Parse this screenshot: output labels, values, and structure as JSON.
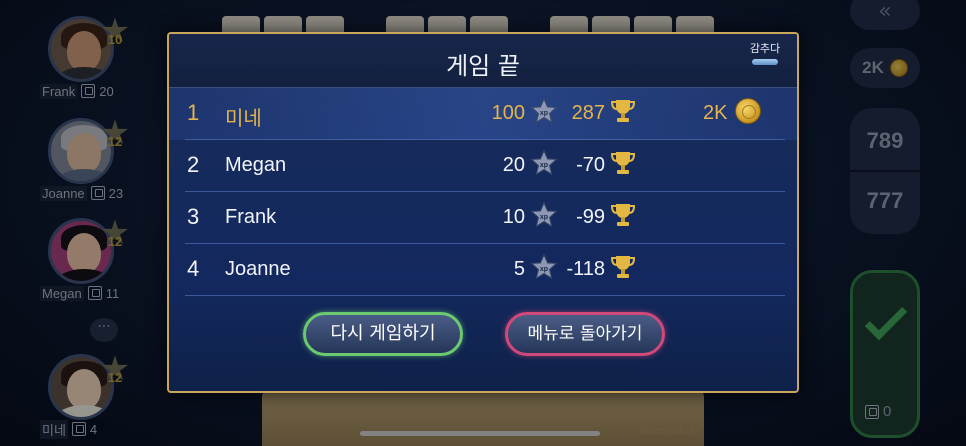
{
  "sidebar": {
    "players": [
      {
        "name": "Frank",
        "cards": "20",
        "level": "10"
      },
      {
        "name": "Joanne",
        "cards": "23",
        "level": "12"
      },
      {
        "name": "Megan",
        "cards": "11",
        "level": "12"
      },
      {
        "name": "미네",
        "cards": "4",
        "level": "12"
      }
    ],
    "chat_icon": "chat-bubble-icon"
  },
  "right_panel": {
    "back_icon": "double-chevron-left-icon",
    "coins": "2K",
    "score_top": "789",
    "score_bottom": "777",
    "confirm_icon": "checkmark-icon",
    "card_count": "0"
  },
  "board": {
    "brand": "Rummikub"
  },
  "dialog": {
    "title": "게임 끝",
    "hide_label": "감추다",
    "results": [
      {
        "rank": "1",
        "name": "미네",
        "xp": "100",
        "trophies": "287",
        "coins": "2K"
      },
      {
        "rank": "2",
        "name": "Megan",
        "xp": "20",
        "trophies": "-70"
      },
      {
        "rank": "3",
        "name": "Frank",
        "xp": "10",
        "trophies": "-99"
      },
      {
        "rank": "4",
        "name": "Joanne",
        "xp": "5",
        "trophies": "-118"
      }
    ],
    "play_again_label": "다시 게임하기",
    "back_to_menu_label": "메뉴로 돌아가기"
  }
}
